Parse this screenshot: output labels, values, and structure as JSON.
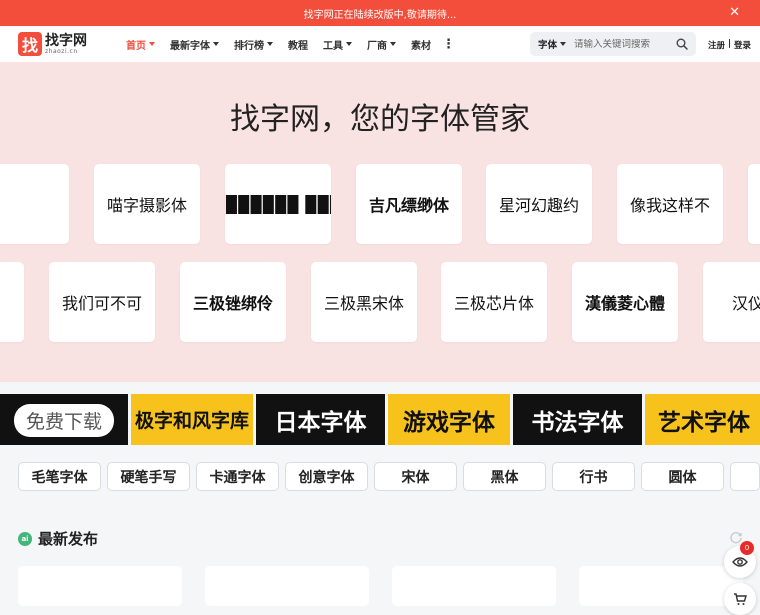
{
  "notice": {
    "text": "找字网正在陆续改版中,敬请期待...",
    "close": "✕"
  },
  "logo": {
    "cn": "找字网",
    "en": "zhaozi.cn"
  },
  "nav": [
    {
      "label": "首页",
      "caret": true,
      "active": true
    },
    {
      "label": "最新字体",
      "caret": true
    },
    {
      "label": "排行榜",
      "caret": true
    },
    {
      "label": "教程",
      "caret": false
    },
    {
      "label": "工具",
      "caret": true
    },
    {
      "label": "厂商",
      "caret": true
    },
    {
      "label": "素材",
      "caret": false
    }
  ],
  "nav_more": "⋮",
  "search": {
    "type": "字体",
    "placeholder": "请输入关键词搜索"
  },
  "auth": {
    "register": "注册",
    "sep": " | ",
    "login": "登录"
  },
  "hero": {
    "title": "找字网，您的字体管家",
    "row1": [
      "",
      "喵字摄影体",
      "▉▉▉▉▉▉▉ ▉▉▉",
      "吉凡缥缈体",
      "星河幻趣约",
      "像我这样不",
      ""
    ],
    "row2": [
      "体",
      "我们可不可",
      "三极锉绑伶",
      "三极黑宋体",
      "三极芯片体",
      "漢儀菱心體",
      "汉仪金"
    ]
  },
  "banners": [
    {
      "text": "免费下载",
      "kind": "download"
    },
    {
      "text": "极字和风字库",
      "kind": "yellow"
    },
    {
      "text": "日本字体",
      "kind": "dark"
    },
    {
      "text": "游戏字体",
      "kind": "yellow"
    },
    {
      "text": "书法字体",
      "kind": "dark"
    },
    {
      "text": "艺术字体",
      "kind": "yellow"
    }
  ],
  "banner_hand": "☝",
  "styles": [
    "毛笔字体",
    "硬笔手写",
    "卡通字体",
    "创意字体",
    "宋体",
    "黑体",
    "行书",
    "圆体",
    ""
  ],
  "latest": {
    "title": "最新发布",
    "icon_text": "ai"
  },
  "float_badge": "0",
  "colors": {
    "accent": "#f24e3b",
    "hero_bg": "#f8e3e2",
    "banner_yellow": "#f7c21c",
    "banner_dark": "#111111",
    "section_icon": "#44b67a"
  }
}
